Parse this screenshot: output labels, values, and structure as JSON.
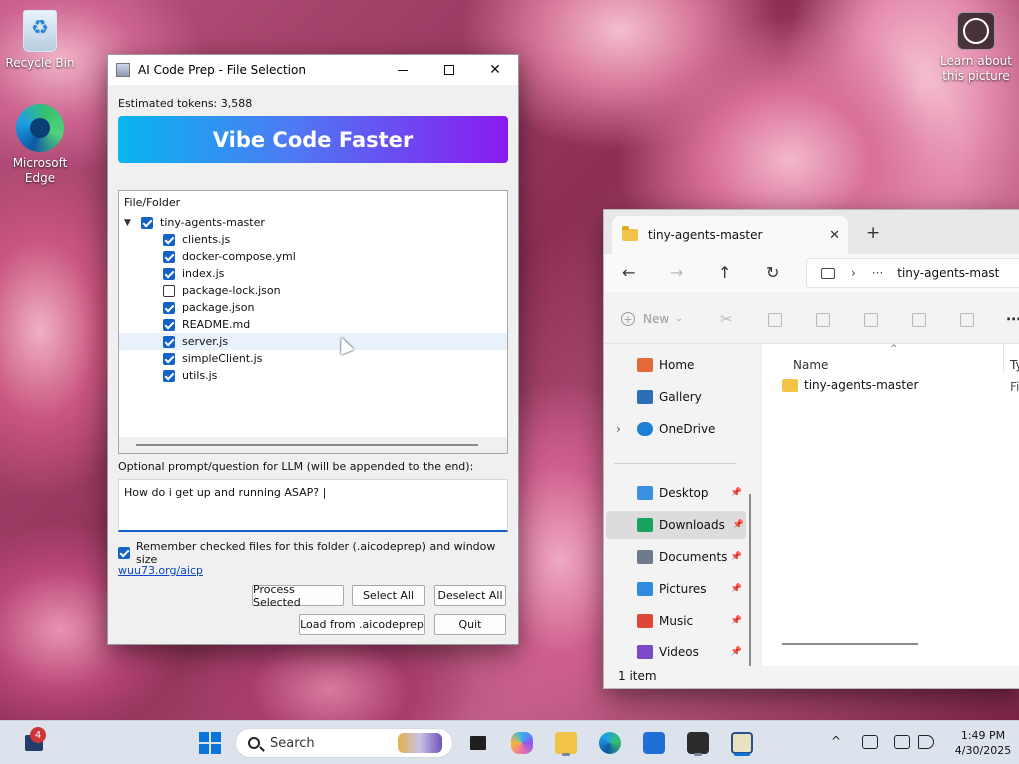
{
  "desktop": {
    "icons": [
      {
        "label": "Recycle Bin",
        "icon": "recycle-bin-icon"
      },
      {
        "label": "Microsoft\nEdge",
        "icon": "edge-icon"
      },
      {
        "label": "Learn about\nthis picture",
        "icon": "spotlight-icon"
      }
    ]
  },
  "aicp": {
    "title": "AI Code Prep - File Selection",
    "tokens": "Estimated tokens: 3,588",
    "banner": "Vibe Code Faster",
    "tree_header": "File/Folder",
    "root": {
      "label": "tiny-agents-master",
      "checked": true
    },
    "files": [
      {
        "label": "clients.js",
        "checked": true
      },
      {
        "label": "docker-compose.yml",
        "checked": true
      },
      {
        "label": "index.js",
        "checked": true
      },
      {
        "label": "package-lock.json",
        "checked": false
      },
      {
        "label": "package.json",
        "checked": true
      },
      {
        "label": "README.md",
        "checked": true
      },
      {
        "label": "server.js",
        "checked": true
      },
      {
        "label": "simpleClient.js",
        "checked": true
      },
      {
        "label": "utils.js",
        "checked": true
      }
    ],
    "prompt_label": "Optional prompt/question for LLM (will be appended to the end):",
    "prompt_value": "How do i get up and running ASAP? |",
    "remember_label": "Remember checked files for this folder (.aicodeprep) and window size",
    "remember_checked": true,
    "link": "wuu73.org/aicp",
    "buttons": {
      "process": "Process Selected",
      "select_all": "Select All",
      "deselect_all": "Deselect All",
      "load": "Load from .aicodeprep",
      "quit": "Quit"
    },
    "colors": {
      "banner_start": "#07b6f0",
      "banner_end": "#8a1af0",
      "check": "#1262c7"
    }
  },
  "explorer": {
    "tab_title": "tiny-agents-master",
    "address_path": "tiny-agents-mast",
    "new_label": "New",
    "nav_items": [
      {
        "label": "Home",
        "color": "#e46a3a"
      },
      {
        "label": "Gallery",
        "color": "#2b6fb8"
      },
      {
        "label": "OneDrive",
        "color": "#1e7fd8"
      },
      {
        "label": "Desktop",
        "color": "#3a8fe0"
      },
      {
        "label": "Downloads",
        "color": "#1aa35f"
      },
      {
        "label": "Documents",
        "color": "#6c7a8c"
      },
      {
        "label": "Pictures",
        "color": "#2f8be0"
      },
      {
        "label": "Music",
        "color": "#e0453a"
      },
      {
        "label": "Videos",
        "color": "#7b48c9"
      }
    ],
    "column_name": "Name",
    "column_type": "Ty",
    "file_name": "tiny-agents-master",
    "file_type": "Fi",
    "status": "1 item"
  },
  "taskbar": {
    "badge": "4",
    "search_placeholder": "Search",
    "time": "1:49 PM",
    "date": "4/30/2025"
  }
}
